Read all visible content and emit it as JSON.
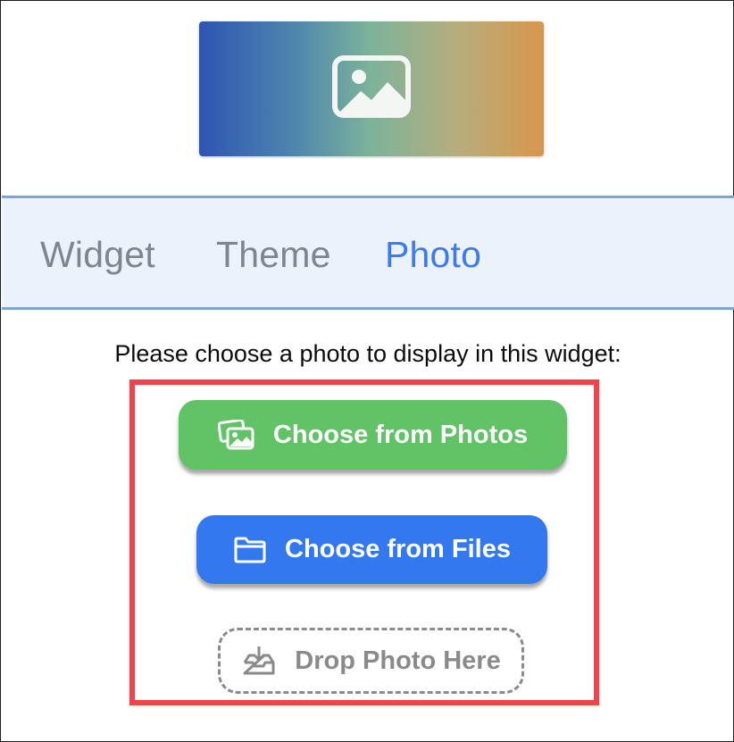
{
  "preview": {
    "icon": "image-icon"
  },
  "tabs": [
    {
      "label": "Widget",
      "active": false
    },
    {
      "label": "Theme",
      "active": false
    },
    {
      "label": "Photo",
      "active": true
    }
  ],
  "photo_panel": {
    "prompt": "Please choose a photo to display in this widget:",
    "choose_photos_label": "Choose from Photos",
    "choose_photos_icon": "photos-stack-icon",
    "choose_files_label": "Choose from Files",
    "choose_files_icon": "folder-icon",
    "drop_label": "Drop Photo Here",
    "drop_icon": "tray-download-icon"
  },
  "colors": {
    "active_tab": "#3b7bee",
    "inactive_tab": "#7f8590",
    "photos_button": "#61c366",
    "files_button": "#3478f0",
    "highlight_border": "#f0434b"
  }
}
